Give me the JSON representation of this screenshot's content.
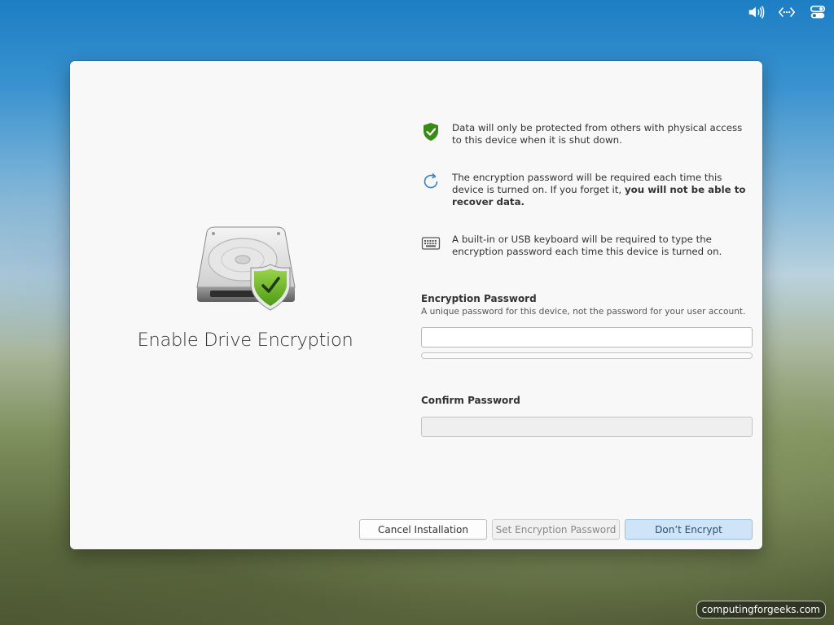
{
  "tray": {
    "icons": [
      "volume-icon",
      "network-icon",
      "system-settings-icon"
    ]
  },
  "hero": {
    "title": "Enable Drive Encryption",
    "shield_color": "#68b723"
  },
  "info": [
    {
      "icon": "shield-check-icon",
      "text": "Data will only be protected from others with physical access to this device when it is shut down."
    },
    {
      "icon": "refresh-icon",
      "text_before": "The encryption password will be required each time this device is turned on. If you forget it, ",
      "text_bold": "you will not be able to recover data."
    },
    {
      "icon": "keyboard-icon",
      "text": "A built-in or USB keyboard will be required to type the encryption password each time this device is turned on."
    }
  ],
  "form": {
    "password": {
      "title": "Encryption Password",
      "hint": "A unique password for this device, not the password for your user account.",
      "value": "",
      "strength": 0
    },
    "confirm": {
      "title": "Confirm Password",
      "value": ""
    }
  },
  "buttons": {
    "cancel": "Cancel Installation",
    "set_password": "Set Encryption Password",
    "dont_encrypt": "Don’t Encrypt"
  },
  "watermark": "computingforgeeks.com"
}
